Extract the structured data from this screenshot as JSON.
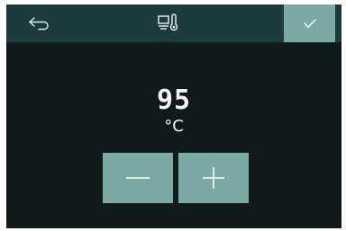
{
  "header": {
    "back_icon": "back-arrow-icon",
    "title_icon": "core-probe-thermometer-icon",
    "confirm_icon": "checkmark-icon"
  },
  "setpoint": {
    "value": "95",
    "unit": "°C"
  },
  "controls": {
    "decrement_icon": "minus-icon",
    "increment_icon": "plus-icon"
  },
  "colors": {
    "background": "#101a1b",
    "header": "#1d3a3c",
    "accent": "#7ba9a4",
    "text": "#f2f2f2"
  }
}
